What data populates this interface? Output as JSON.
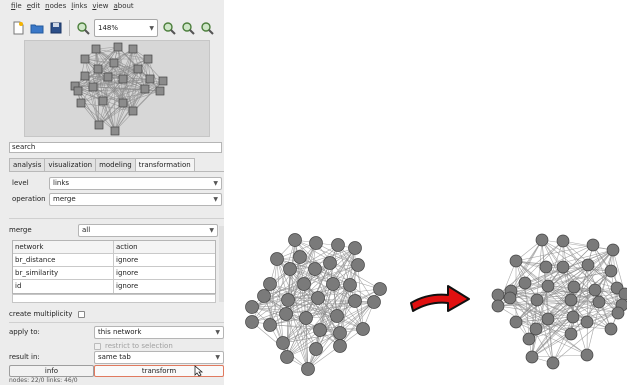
{
  "menu": [
    "file",
    "edit",
    "nodes",
    "links",
    "view",
    "about"
  ],
  "toolbar": {
    "zoom_value": "148%",
    "buttons": [
      "new-file-icon",
      "open-folder-icon",
      "save-disk-icon",
      "zoom-fit-icon",
      "zoom-in-icon",
      "zoom-out-icon",
      "zoom-reset-icon"
    ]
  },
  "search": {
    "value": "search"
  },
  "tabs": [
    {
      "label": "analysis",
      "active": false
    },
    {
      "label": "visualization",
      "active": false
    },
    {
      "label": "modeling",
      "active": false
    },
    {
      "label": "transformation",
      "active": true
    }
  ],
  "transform": {
    "level_label": "level",
    "level_value": "links",
    "operation_label": "operation",
    "operation_value": "merge",
    "merge_label": "merge",
    "merge_value": "all",
    "table": {
      "headers": [
        "network",
        "action"
      ],
      "rows": [
        [
          "br_distance",
          "ignore"
        ],
        [
          "br_similarity",
          "ignore"
        ],
        [
          "id",
          "ignore"
        ]
      ]
    },
    "create_multiplicity_label": "create multiplicity",
    "apply_to_label": "apply to:",
    "apply_to_value": "this network",
    "restrict_label": "restrict to selection",
    "result_in_label": "result in:",
    "result_in_value": "same tab",
    "info_button": "info",
    "transform_button": "transform"
  },
  "status_bar": "nodes: 22/0  links: 46/0",
  "colors": {
    "panel_bg": "#ececec",
    "node_fill": "#7a7a7a",
    "node_stroke": "#444444",
    "edge": "#8a8a8a",
    "arrow_red": "#e01010"
  }
}
